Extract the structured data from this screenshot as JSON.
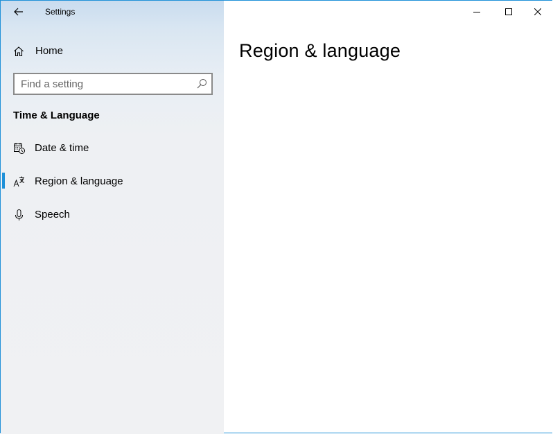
{
  "window": {
    "title": "Settings",
    "accent_color": "#1e90d8"
  },
  "titlebar": {
    "back_icon": "back-arrow-icon",
    "caption_buttons": [
      "minimize-icon",
      "maximize-icon",
      "close-icon"
    ]
  },
  "sidebar": {
    "home": {
      "label": "Home",
      "icon": "home-icon"
    },
    "search": {
      "placeholder": "Find a setting",
      "value": "",
      "icon": "search-icon"
    },
    "section_heading": "Time & Language",
    "items": [
      {
        "label": "Date & time",
        "icon": "calendar-clock-icon",
        "selected": false
      },
      {
        "label": "Region & language",
        "icon": "language-icon",
        "selected": true
      },
      {
        "label": "Speech",
        "icon": "microphone-icon",
        "selected": false
      }
    ]
  },
  "main": {
    "page_title": "Region & language"
  }
}
